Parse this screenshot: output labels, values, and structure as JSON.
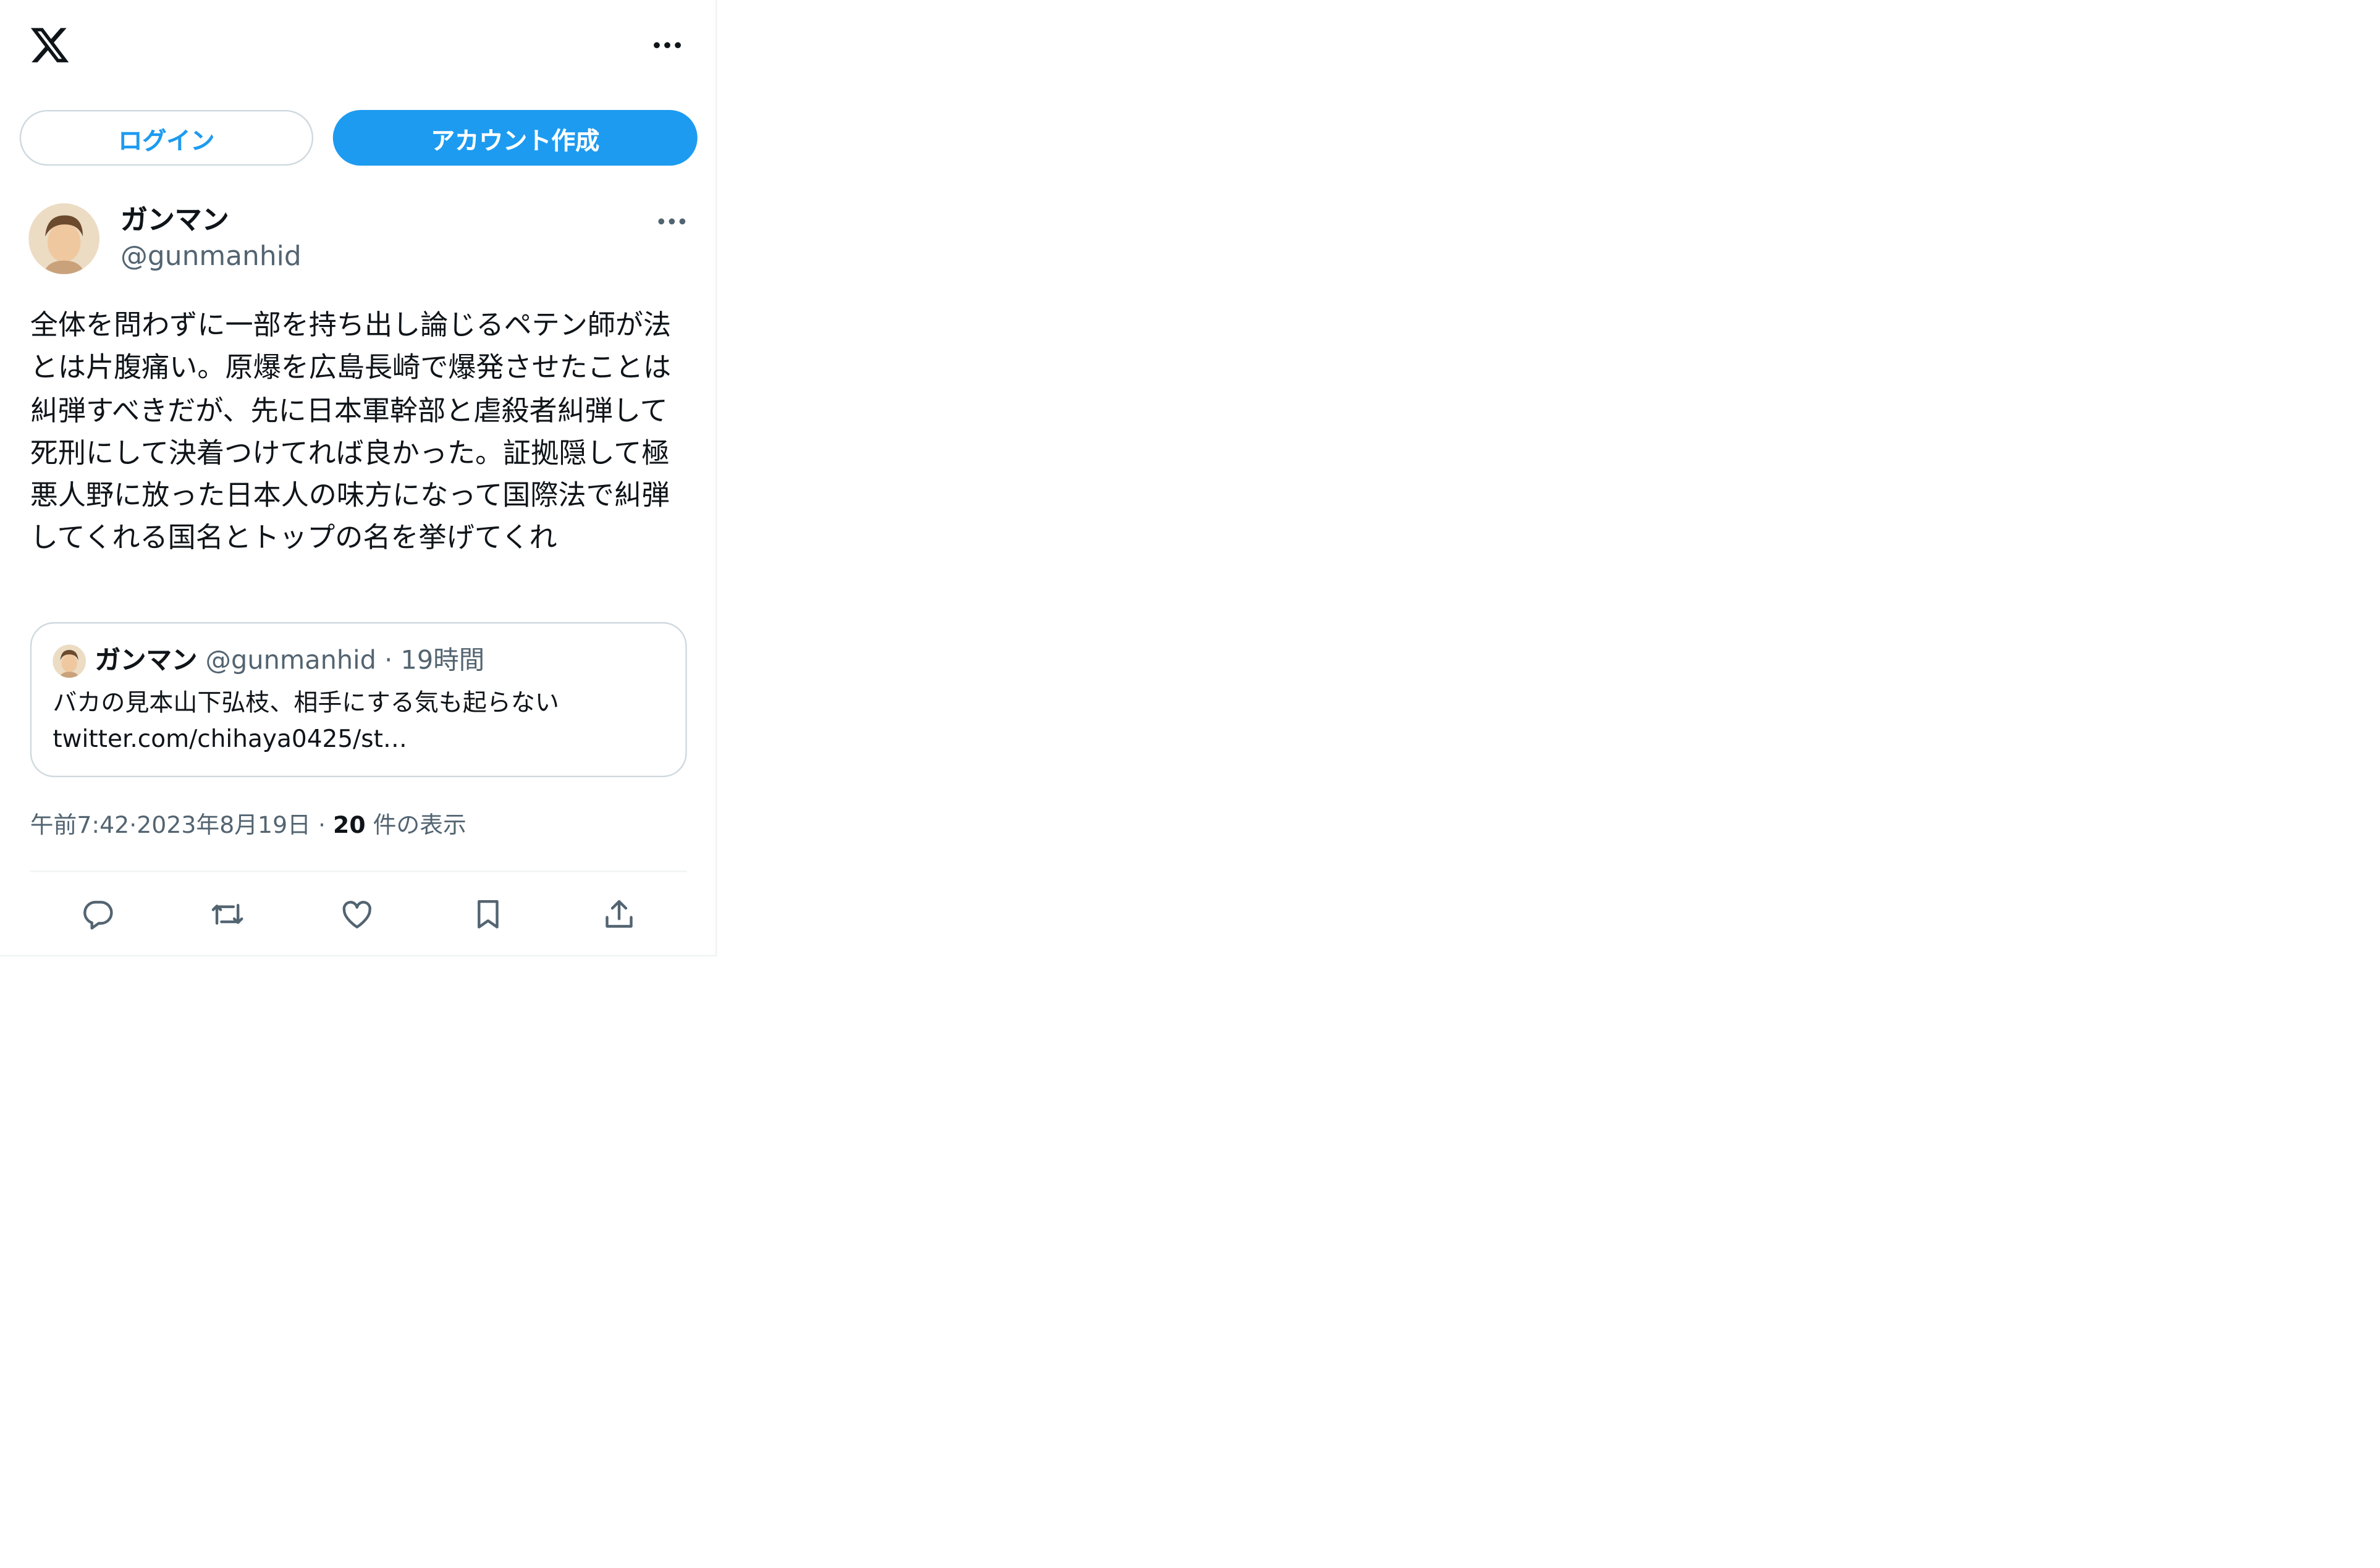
{
  "header": {
    "logo_icon": "x-logo-icon",
    "more_icon": "more-icon"
  },
  "auth": {
    "login_label": "ログイン",
    "signup_label": "アカウント作成"
  },
  "tweet": {
    "author_name": "ガンマン",
    "author_handle": "@gunmanhid",
    "text": "全体を問わずに一部を持ち出し論じるペテン師が法とは片腹痛い。原爆を広島長崎で爆発させたことは糾弾すべきだが、先に日本軍幹部と虐殺者糾弾して死刑にして決着つけてれば良かった。証拠隠して極悪人野に放った日本人の味方になって国際法で糾弾してくれる国名とトップの名を挙げてくれ",
    "quote": {
      "author_name": "ガンマン",
      "author_handle": "@gunmanhid",
      "separator": "·",
      "time_ago": "19時間",
      "line1": "バカの見本山下弘枝、相手にする気も起らない",
      "line2": "twitter.com/chihaya0425/st…"
    },
    "meta": {
      "time": "午前7:42",
      "dot1": "·",
      "date": "2023年8月19日",
      "dot2": "·",
      "views_count": "20",
      "views_label": "件の表示"
    },
    "actions": [
      "reply-icon",
      "retweet-icon",
      "like-icon",
      "bookmark-icon",
      "share-icon"
    ]
  },
  "colors": {
    "accent": "#1d9bf0",
    "text": "#0f1419",
    "secondary": "#536471",
    "border": "#cfd9de"
  }
}
